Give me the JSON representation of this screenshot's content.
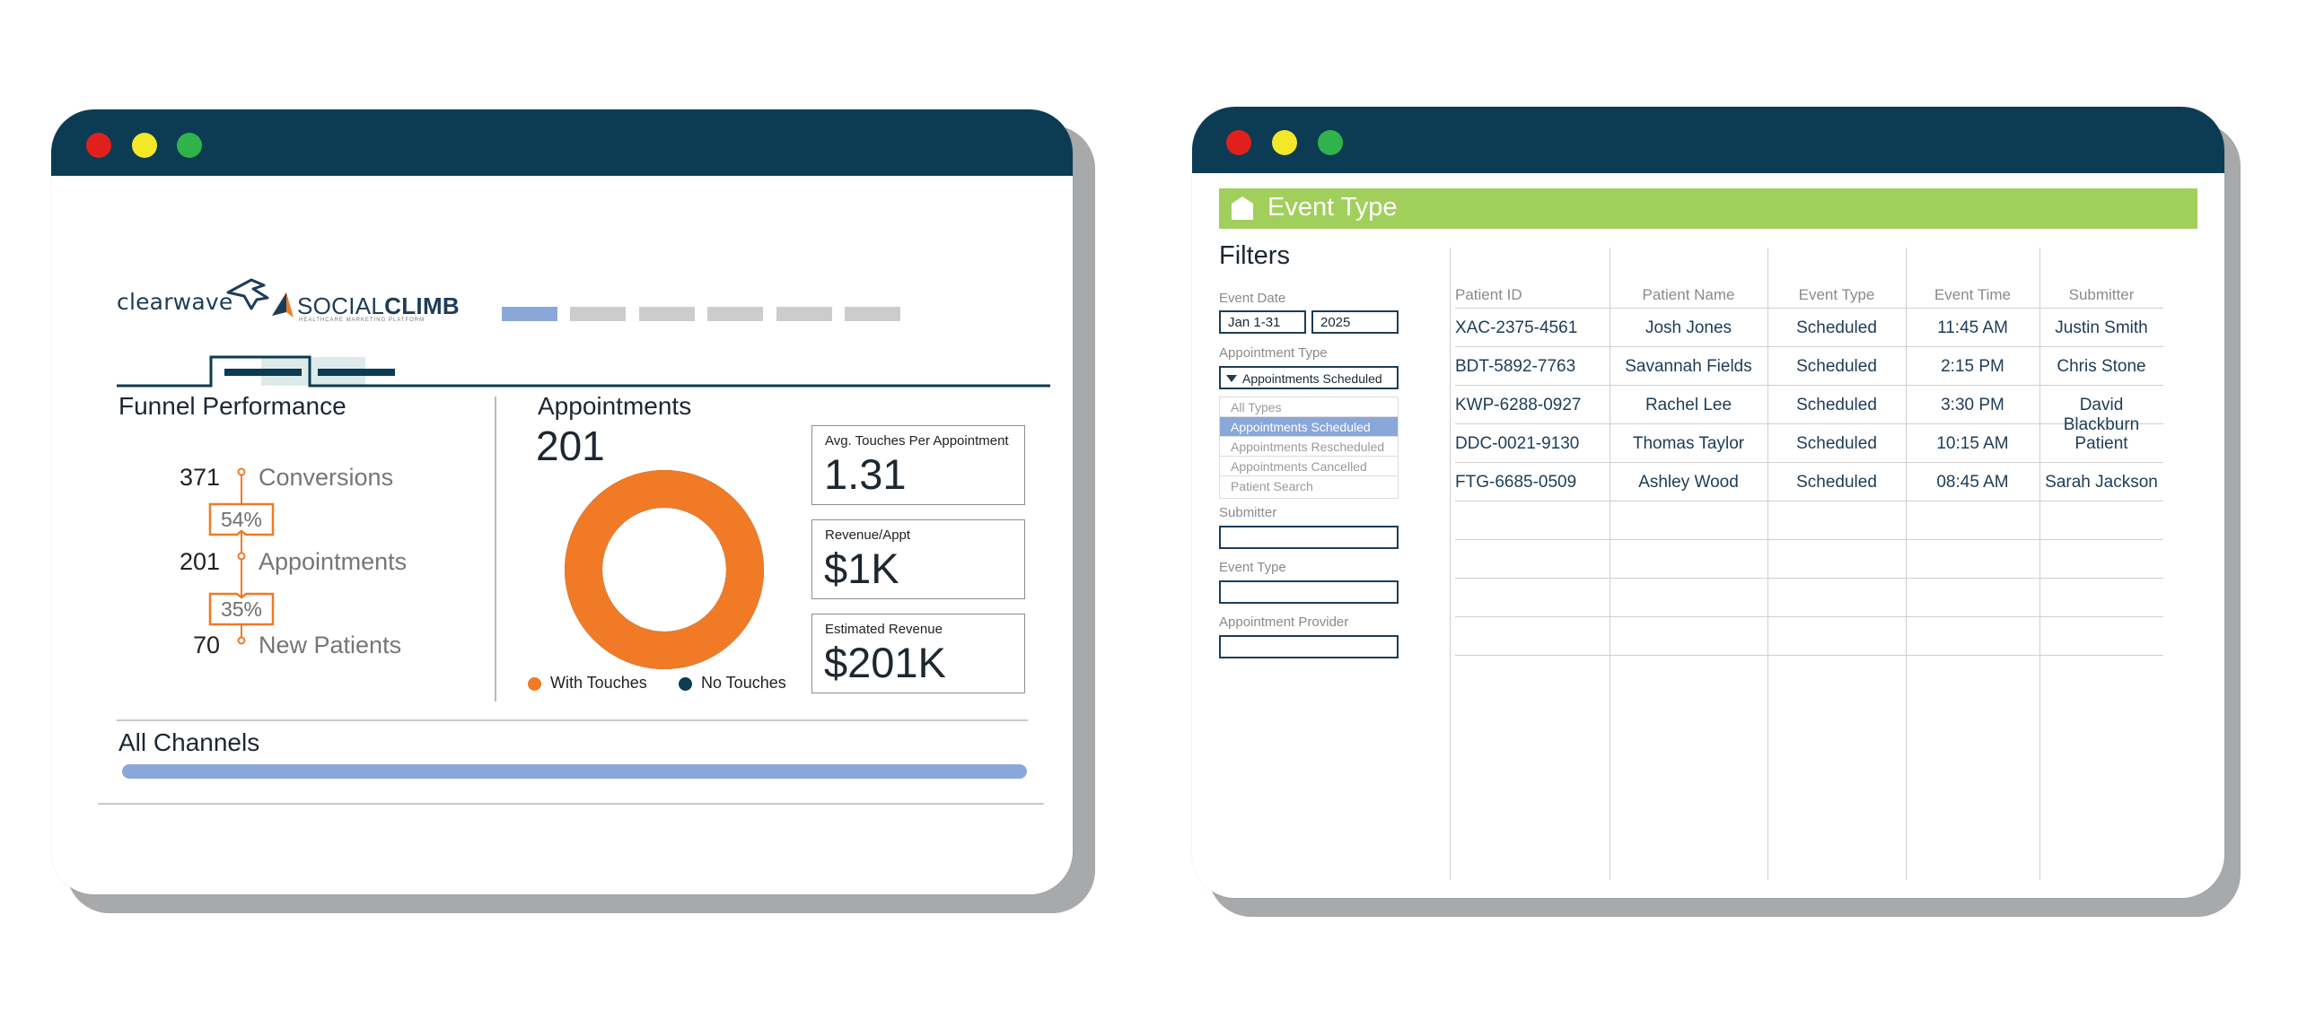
{
  "colors": {
    "titlebar": "#0b3c53",
    "dot_red": "#e0211b",
    "dot_yellow": "#f3e72a",
    "dot_green": "#2fb34a",
    "orange": "#f07a26",
    "navy": "#1d3c58",
    "nav_active": "#8aa7d9",
    "nav_inactive": "#cccccc",
    "banner_green": "#a1cf5b",
    "selected_blue": "#8aa7d9"
  },
  "dashboard": {
    "logos": {
      "clearwave": "clearwave",
      "socialclimb_light": "SOCIAL",
      "socialclimb_bold": "CLIMB",
      "socialclimb_sub": "HEALTHCARE MARKETING PLATFORM"
    },
    "funnel": {
      "title": "Funnel Performance",
      "steps": [
        {
          "value": "371",
          "label": "Conversions"
        },
        {
          "value": "201",
          "label": "Appointments"
        },
        {
          "value": "70",
          "label": "New Patients"
        }
      ],
      "rates": [
        "54%",
        "35%"
      ]
    },
    "appointments": {
      "title": "Appointments",
      "total": "201",
      "donut": {
        "with_touches_share": 1.0
      },
      "legend": [
        {
          "label": "With Touches",
          "color": "#f07a26"
        },
        {
          "label": "No Touches",
          "color": "#0b3c53"
        }
      ]
    },
    "kpis": [
      {
        "label": "Avg. Touches Per Appointment",
        "value": "1.31"
      },
      {
        "label": "Revenue/Appt",
        "value": "$1K"
      },
      {
        "label": "Estimated Revenue",
        "value": "$201K"
      }
    ],
    "channels": {
      "title": "All Channels"
    }
  },
  "events": {
    "banner_title": "Event Type",
    "filters": {
      "title": "Filters",
      "event_date_label": "Event Date",
      "date_range": "Jan 1-31",
      "year": "2025",
      "appointment_type_label": "Appointment Type",
      "appointment_type_value": "Appointments Scheduled",
      "options": [
        {
          "label": "All Types",
          "selected": false
        },
        {
          "label": "Appointments Scheduled",
          "selected": true
        },
        {
          "label": "Appointments Rescheduled",
          "selected": false
        },
        {
          "label": "Appointments Cancelled",
          "selected": false
        },
        {
          "label": "Patient Search",
          "selected": false
        }
      ],
      "submitter_label": "Submitter",
      "event_type_label": "Event Type",
      "provider_label": "Appointment Provider"
    },
    "table": {
      "columns": [
        "Patient ID",
        "Patient Name",
        "Event Type",
        "Event Time",
        "Submitter"
      ],
      "rows": [
        [
          "XAC-2375-4561",
          "Josh Jones",
          "Scheduled",
          "11:45 AM",
          "Justin Smith"
        ],
        [
          "BDT-5892-7763",
          "Savannah Fields",
          "Scheduled",
          "2:15 PM",
          "Chris Stone"
        ],
        [
          "KWP-6288-0927",
          "Rachel Lee",
          "Scheduled",
          "3:30 PM",
          "David Blackburn"
        ],
        [
          "DDC-0021-9130",
          "Thomas Taylor",
          "Scheduled",
          "10:15 AM",
          "Patient"
        ],
        [
          "FTG-6685-0509",
          "Ashley Wood",
          "Scheduled",
          "08:45 AM",
          "Sarah Jackson"
        ]
      ]
    }
  }
}
